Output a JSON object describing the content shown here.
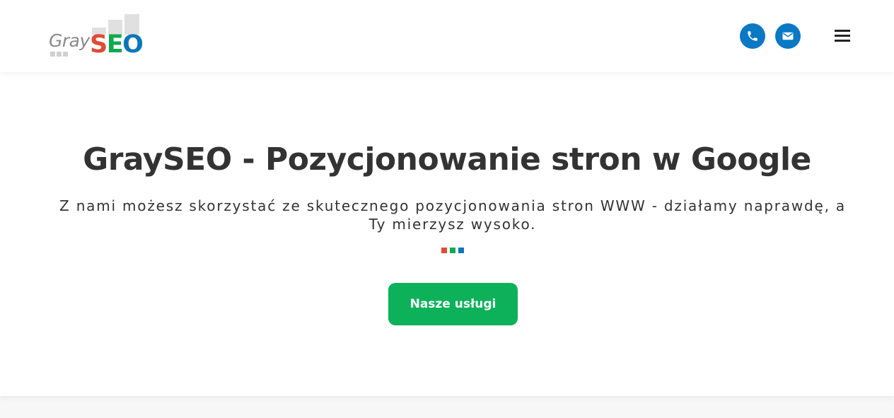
{
  "header": {
    "logo": {
      "gray_text": "Gray",
      "seo_s": "S",
      "seo_e": "E",
      "seo_o": "O"
    },
    "phone_icon": "phone-icon",
    "mail_icon": "envelope-icon",
    "menu_icon": "hamburger-menu-icon"
  },
  "hero": {
    "title": "GraySEO - Pozycjonowanie stron w Google",
    "subtitle": "Z nami możesz skorzystać ze skutecznego pozycjonowania stron WWW - działamy naprawdę, a Ty mierzysz wysoko.",
    "cta_label": "Nasze usługi"
  },
  "colors": {
    "red": "#e04b35",
    "green": "#0fa94f",
    "blue": "#0a78b8",
    "icon_blue": "#0a78c3",
    "cta_green": "#0cb15a",
    "text": "#333333"
  }
}
